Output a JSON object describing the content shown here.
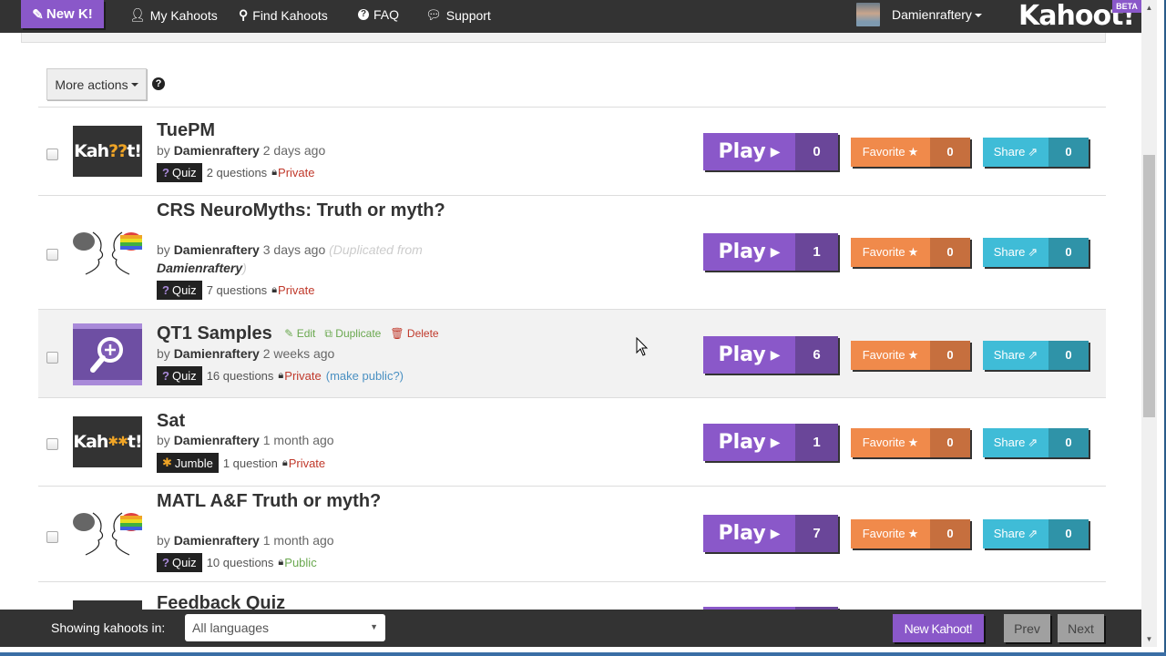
{
  "navbar": {
    "new_k_label": "New K!",
    "links": [
      {
        "label": "My Kahoots",
        "icon": "user-icon"
      },
      {
        "label": "Find Kahoots",
        "icon": "search-icon"
      },
      {
        "label": "FAQ",
        "icon": "question-circle-icon"
      },
      {
        "label": "Support",
        "icon": "comment-icon"
      }
    ],
    "username": "Damienraftery",
    "logo": "Kahoot!",
    "beta": "BETA"
  },
  "toolbar": {
    "more_actions": "More actions",
    "help": "?"
  },
  "kahoots": [
    {
      "title": "TuePM",
      "by": "by",
      "author": "Damienraftery",
      "age": "2 days ago",
      "type": "Quiz",
      "questions": "2 questions",
      "visibility": "Private",
      "plays": "0",
      "favorites": "0",
      "shares": "0"
    },
    {
      "title": "CRS NeuroMyths: Truth or myth?",
      "by": "by",
      "author": "Damienraftery",
      "age": "3 days ago",
      "duplicated_prefix": "(Duplicated from",
      "duplicated_author": "Damienraftery",
      "duplicated_suffix": ")",
      "type": "Quiz",
      "questions": "7 questions",
      "visibility": "Private",
      "plays": "1",
      "favorites": "0",
      "shares": "0"
    },
    {
      "title": "QT1 Samples",
      "edit": "Edit",
      "duplicate": "Duplicate",
      "delete": "Delete",
      "by": "by",
      "author": "Damienraftery",
      "age": "2 weeks ago",
      "type": "Quiz",
      "questions": "16 questions",
      "visibility": "Private",
      "make_public": "(make public?)",
      "plays": "6",
      "favorites": "0",
      "shares": "0"
    },
    {
      "title": "Sat",
      "by": "by",
      "author": "Damienraftery",
      "age": "1 month ago",
      "type": "Jumble",
      "questions": "1 question",
      "visibility": "Private",
      "plays": "1",
      "favorites": "0",
      "shares": "0"
    },
    {
      "title": "MATL A&F Truth or myth?",
      "by": "by",
      "author": "Damienraftery",
      "age": "1 month ago",
      "type": "Quiz",
      "questions": "10 questions",
      "visibility": "Public",
      "plays": "7",
      "favorites": "0",
      "shares": "0"
    },
    {
      "title": "Feedback Quiz"
    }
  ],
  "buttons": {
    "play": "Play",
    "favorite": "Favorite",
    "share": "Share"
  },
  "footer": {
    "showing_label": "Showing kahoots in:",
    "language": "All languages",
    "new_kahoot": "New Kahoot!",
    "prev": "Prev",
    "next": "Next"
  },
  "thumb_text": {
    "kahoot_a": "Kah",
    "kahoot_q": "??",
    "kahoot_b": "t!",
    "jumble_q": "✱✱"
  },
  "colors": {
    "brand_purple": "#8a58c9",
    "favorite_orange": "#f08a4b",
    "share_teal": "#3fbcd7",
    "private_red": "#c0392b",
    "public_green": "#6aa84f"
  }
}
